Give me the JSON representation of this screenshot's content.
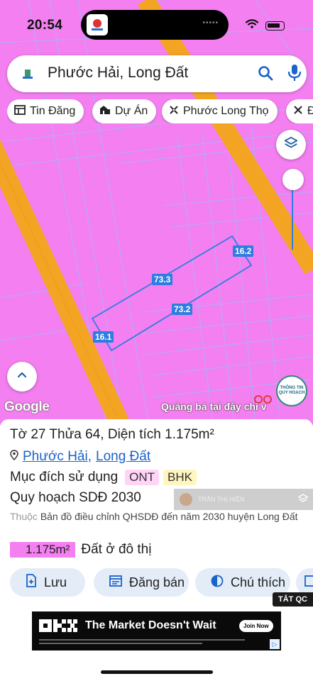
{
  "status_bar": {
    "time": "20:54"
  },
  "search": {
    "query": "Phước Hải, Long Đất"
  },
  "chips": [
    {
      "label": "Tin Đăng",
      "icon": "newspaper-icon"
    },
    {
      "label": "Dự Án",
      "icon": "buildings-icon"
    },
    {
      "label": "Phước Long Thọ",
      "icon": "close-icon"
    },
    {
      "label": "Đ",
      "icon": "close-icon"
    }
  ],
  "map": {
    "edge_labels": [
      "16.2",
      "73.3",
      "73.2",
      "16.1"
    ],
    "google_label": "Google",
    "ad_label": "Quảng bá tại đây chi v",
    "qh_badge": [
      "THÔNG TIN",
      "QUY HOẠCH"
    ]
  },
  "panel": {
    "title": "Tờ 27 Thửa 64, Diện tích 1.175m²",
    "ward": "Phước Hải",
    "separator": ",",
    "district": "Long Đất",
    "purpose_label": "Mục đích sử dụng",
    "purpose_tags": [
      "ONT",
      "BHK"
    ],
    "plan_title": "Quy hoạch SDĐ 2030",
    "desc_prefix": "Thuộc",
    "desc_text": "Bản đồ điều chỉnh QHSDĐ đến năm 2030 huyện Long Đất",
    "area_value": "1.175m²",
    "area_type": "Đất ở đô thị",
    "overlay_user": "TRẦN THỊ HIỀN",
    "actions": [
      "Lưu",
      "Đăng bán",
      "Chú thích"
    ],
    "tat_qc": "TẮT QC"
  },
  "ad_banner": {
    "brand": "OKX",
    "headline": "The Market Doesn't Wait",
    "cta": "Join Now"
  },
  "colors": {
    "land_pink": "#f47ff0",
    "road_orange": "#f4a423",
    "edge_blue": "#2f7de0",
    "link_blue": "#1a63c8"
  }
}
